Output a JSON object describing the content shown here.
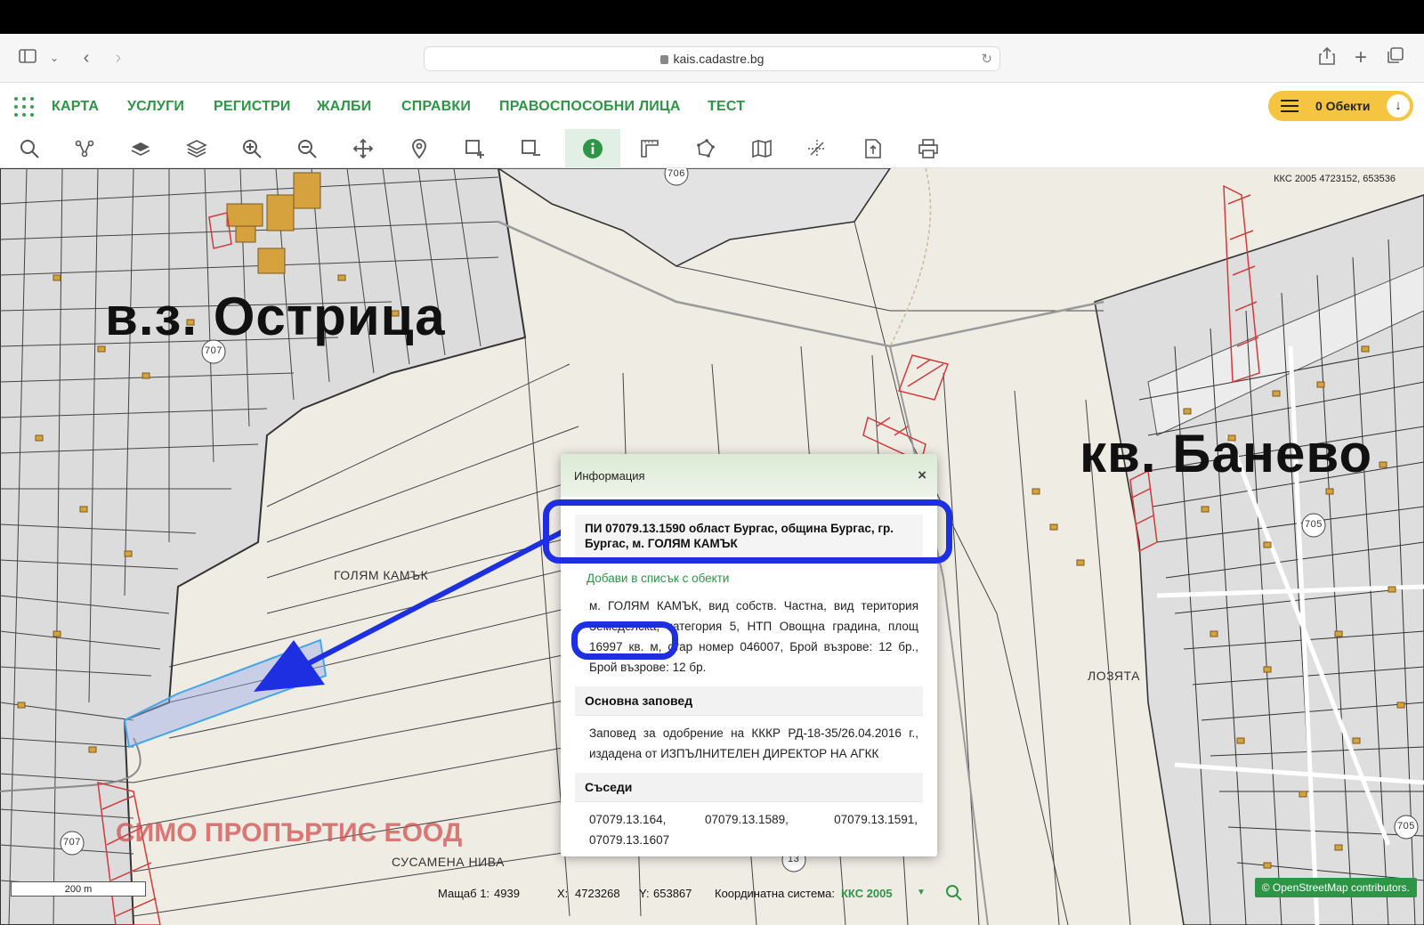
{
  "browser": {
    "url": "kais.cadastre.bg"
  },
  "nav": {
    "items": [
      "КАРТА",
      "УСЛУГИ",
      "РЕГИСТРИ",
      "ЖАЛБИ",
      "СПРАВКИ",
      "ПРАВОСПОСОБНИ ЛИЦА",
      "ТЕСТ"
    ],
    "objects_label": "0 Обекти"
  },
  "toolbar": {
    "tools": [
      "search-icon",
      "route-icon",
      "layer-single-icon",
      "layers-icon",
      "zoom-in-icon",
      "zoom-out-icon",
      "pan-icon",
      "location-pin-icon",
      "select-add-icon",
      "select-remove-icon",
      "info-icon",
      "measure-icon",
      "polygon-icon",
      "map-icon",
      "grid-icon",
      "export-icon",
      "print-icon"
    ],
    "active_tool": "info-icon"
  },
  "map": {
    "coords_top": "ККС 2005 4723152, 653536",
    "area_left": "в.з. Острица",
    "area_right": "кв. Банево",
    "labels": [
      "ГОЛЯМ КАМЪК",
      "ЛОЗЯТА",
      "СУСАМЕНА НИВА"
    ],
    "road_numbers": [
      "706",
      "707",
      "705",
      "705",
      "707",
      "13"
    ],
    "watermark": "СИМО ПРОПЪРТИС ЕООД",
    "scale_bar": "200 m",
    "highlight_color": "#1d2fe0"
  },
  "popup": {
    "title": "Информация",
    "close": "×",
    "pi_heading": "ПИ 07079.13.1590 област Бургас, община Бургас, гр. Бургас, м. ГОЛЯМ КАМЪК",
    "add_link": "Добави в списък с обекти",
    "description": "м. ГОЛЯМ КАМЪК, вид собств. Частна, вид територия Земеделска, категория 5, НТП Овощна градина, площ 16997 кв. м, стар номер 046007, Брой възрове: 12 бр., Брой възрове: 12 бр.",
    "order_heading": "Основна заповед",
    "order_text": "Заповед за одобрение на КККР РД-18-35/26.04.2016 г., издадена от ИЗПЪЛНИТЕЛЕН ДИРЕКТОР НА АГКК",
    "neighbors_heading": "Съседи",
    "neighbors": [
      "07079.13.164,",
      "07079.13.1589,",
      "07079.13.1591,",
      "07079.13.1607"
    ]
  },
  "status": {
    "scale_label": "Мащаб 1:",
    "scale_value": "4939",
    "x_label": "X:",
    "x_value": "4723268",
    "y_label": "Y:",
    "y_value": "653867",
    "crs_label": "Координатна система:",
    "crs_value": "ККС 2005",
    "osm": "© OpenStreetMap contributors."
  }
}
